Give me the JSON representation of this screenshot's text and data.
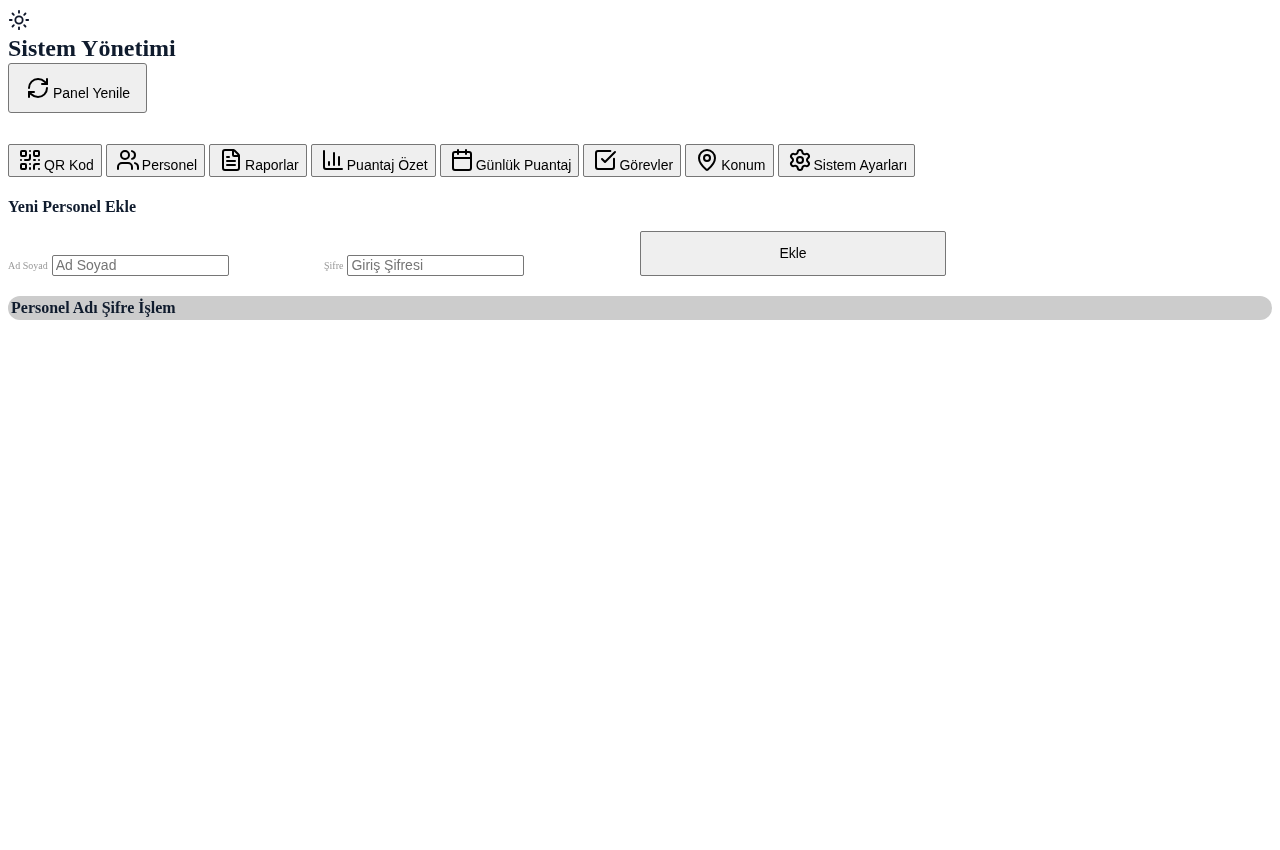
{
  "header": {
    "title": "Sistem Yönetimi",
    "refresh_button": "Panel Yenile"
  },
  "nav_tabs": [
    {
      "label": "QR Kod"
    },
    {
      "label": "Personel"
    },
    {
      "label": "Raporlar"
    },
    {
      "label": "Puantaj Özet"
    },
    {
      "label": "Günlük Puantaj"
    },
    {
      "label": "Görevler"
    },
    {
      "label": "Konum"
    },
    {
      "label": "Sistem Ayarları"
    }
  ],
  "add_form": {
    "title": "Yeni Personel Ekle",
    "fields": [
      {
        "label": "Ad Soyad",
        "placeholder": "Ad Soyad"
      },
      {
        "label": "Şifre",
        "placeholder": "Giriş Şifresi"
      }
    ],
    "submit_button": "Ekle"
  },
  "table": {
    "columns": [
      "Personel Adı",
      "Şifre",
      "İşlem"
    ]
  }
}
